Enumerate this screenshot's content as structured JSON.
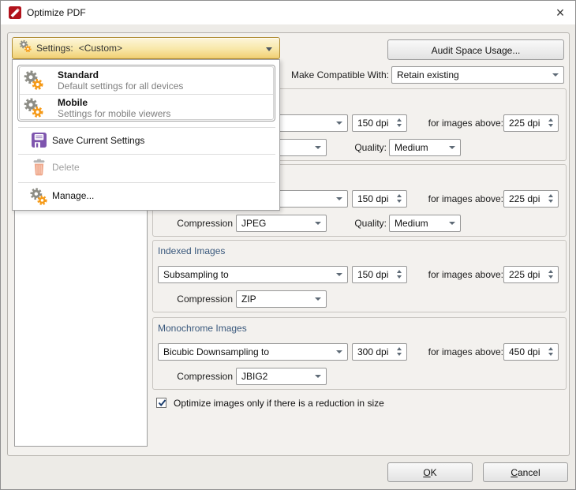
{
  "window": {
    "title": "Optimize PDF",
    "close_glyph": "×"
  },
  "settings_combo": {
    "label": "Settings:",
    "value": "<Custom>"
  },
  "audit_button_label": "Audit Space Usage...",
  "compat": {
    "label": "Make Compatible With:",
    "value": "Retain existing"
  },
  "menu": {
    "presets": [
      {
        "title": "Standard",
        "desc": "Default settings for all devices"
      },
      {
        "title": "Mobile",
        "desc": "Settings for mobile viewers"
      }
    ],
    "save_label": "Save Current Settings",
    "delete_label": "Delete",
    "manage_label": "Manage..."
  },
  "sections": [
    {
      "title": "",
      "method": "",
      "dpi": "150 dpi",
      "above_label": "for images above:",
      "above": "225 dpi",
      "compression_label": "",
      "compression": "",
      "quality_label": "Quality:",
      "quality": "Medium"
    },
    {
      "title": "",
      "method": "",
      "dpi": "150 dpi",
      "above_label": "for images above:",
      "above": "225 dpi",
      "compression_label": "Compression",
      "compression": "JPEG",
      "quality_label": "Quality:",
      "quality": "Medium"
    },
    {
      "title": "Indexed Images",
      "method": "Subsampling to",
      "dpi": "150 dpi",
      "above_label": "for images above:",
      "above": "225 dpi",
      "compression_label": "Compression",
      "compression": "ZIP"
    },
    {
      "title": "Monochrome Images",
      "method": "Bicubic Downsampling to",
      "dpi": "300 dpi",
      "above_label": "for images above:",
      "above": "450 dpi",
      "compression_label": "Compression",
      "compression": "JBIG2"
    }
  ],
  "optimize_checkbox": {
    "checked": true,
    "label": "Optimize images only if there is a reduction in size"
  },
  "buttons": {
    "ok": {
      "key": "O",
      "rest": "K"
    },
    "cancel": {
      "key": "C",
      "rest": "ancel"
    }
  },
  "colors": {
    "accent_gold": "#f1cf72",
    "section_header_blue": "#39587c",
    "gear_orange": "#f59a18",
    "gear_gray": "#8d8d86",
    "save_purple": "#7e55ae",
    "delete_salmon": "#efa98d",
    "logo_red": "#b2131c"
  }
}
